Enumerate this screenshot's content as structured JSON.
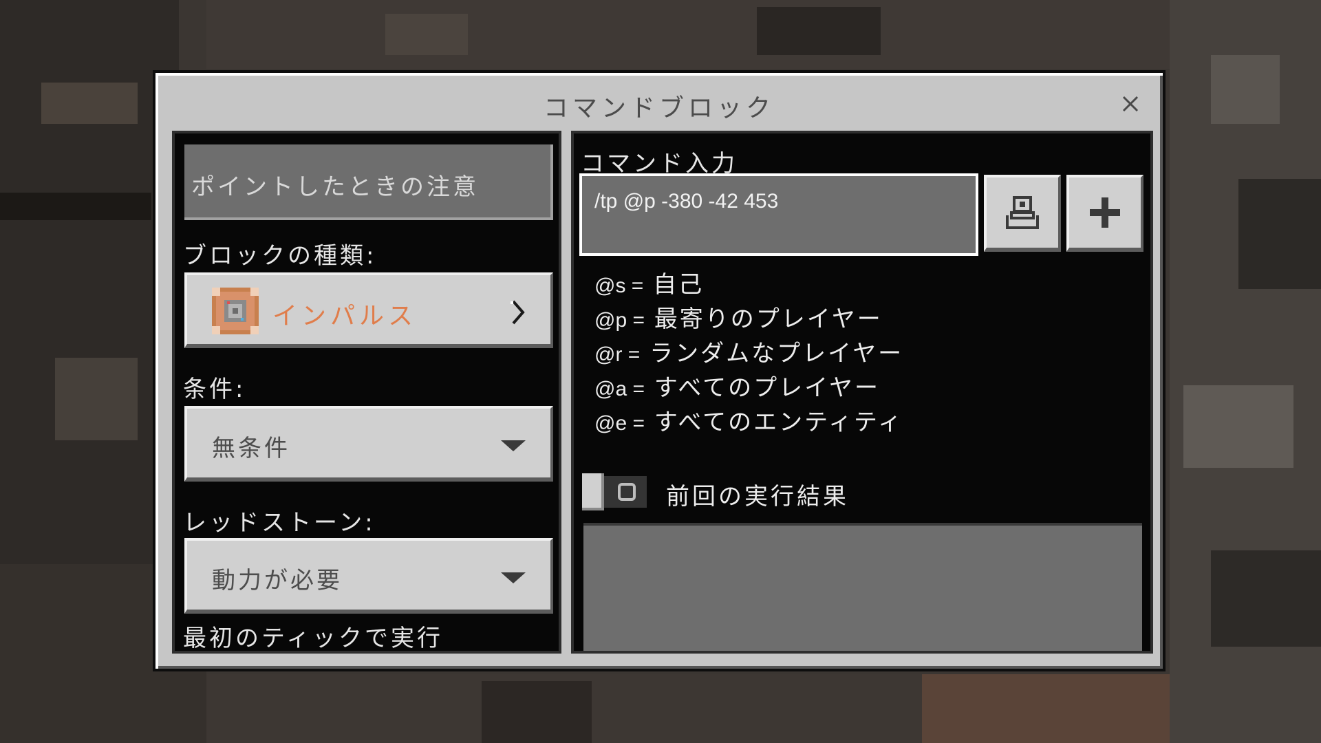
{
  "window": {
    "title": "コマンドブロック",
    "close_icon": "close-icon"
  },
  "left_panel": {
    "hover_note_placeholder": "ポイントしたときの注意",
    "block_type_label": "ブロックの種類:",
    "block_type_value": "インパルス",
    "block_type_color": "#e07d4b",
    "condition_label": "条件:",
    "condition_value": "無条件",
    "redstone_label": "レッドストーン:",
    "redstone_value": "動力が必要",
    "first_tick_label": "最初のティックで実行"
  },
  "right_panel": {
    "command_label": "コマンド入力",
    "command_value": "/tp @p -380 -42 453",
    "help_lines": [
      {
        "selector": "@s =",
        "desc": "自己"
      },
      {
        "selector": "@p =",
        "desc": "最寄りのプレイヤー"
      },
      {
        "selector": "@r =",
        "desc": "ランダムなプレイヤー"
      },
      {
        "selector": "@a =",
        "desc": "すべてのプレイヤー"
      },
      {
        "selector": "@e =",
        "desc": "すべてのエンティティ"
      }
    ],
    "previous_output_label": "前回の実行結果",
    "previous_output_toggle": "off",
    "previous_output_value": ""
  }
}
